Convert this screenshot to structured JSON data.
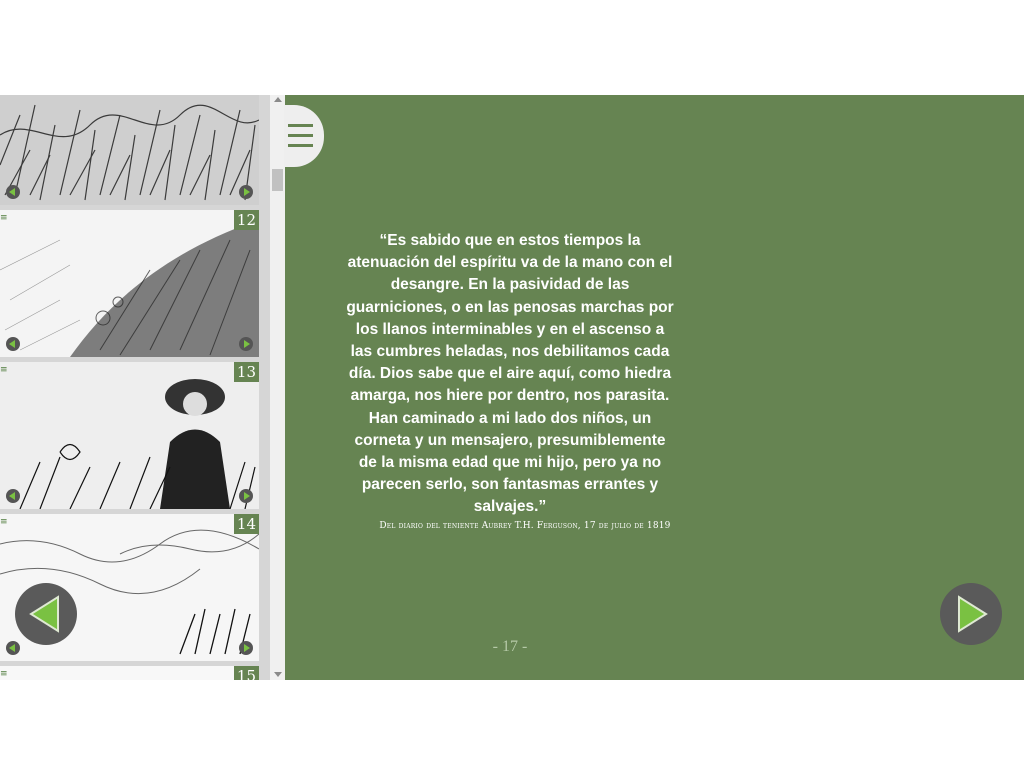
{
  "sidebar": {
    "thumbnails": [
      {
        "number": ""
      },
      {
        "number": "12"
      },
      {
        "number": "13"
      },
      {
        "number": "14"
      },
      {
        "number": "15"
      }
    ]
  },
  "page": {
    "quote": "“Es sabido que en estos tiempos la atenuación del espíritu va de la mano con el desangre. En la pasividad de las guarniciones, o en las penosas marchas por los llanos interminables y en el ascenso a las cumbres heladas, nos debilitamos cada día. Dios sabe que el aire aquí, como hiedra amarga, nos hiere por dentro, nos parasita. Han caminado a mi lado dos niños, un corneta y un mensajero, presumiblemente de la misma edad que mi hijo, pero ya no parecen serlo, son fantasmas errantes y salvajes.”",
    "attribution": "Del diario del teniente Aubrey T.H. Ferguson, 17 de julio de 1819",
    "page_number": "- 17 -"
  },
  "colors": {
    "page_background": "#668452",
    "nav_button": "#5a5a5a",
    "nav_arrow": "#7ac142"
  },
  "icons": [
    "hamburger-menu-icon",
    "arrow-left-icon",
    "arrow-right-icon"
  ]
}
